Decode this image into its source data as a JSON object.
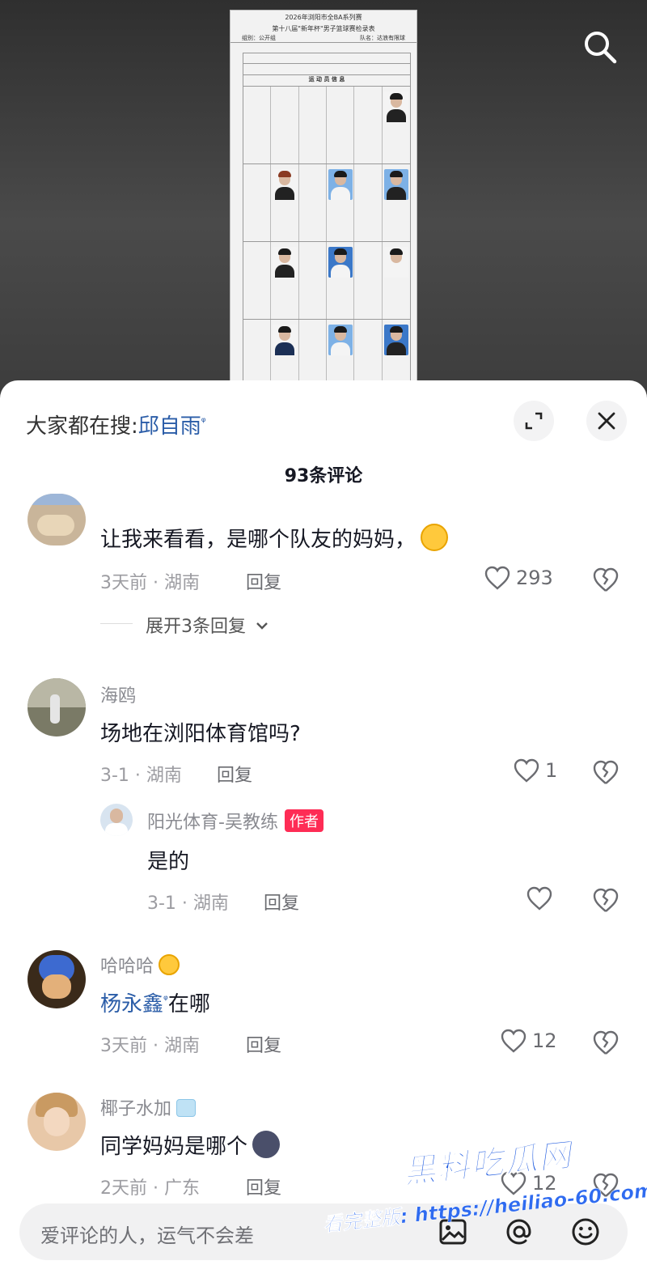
{
  "document": {
    "title_line1": "2026年浏阳市全BA系列赛",
    "title_line2": "第十八届\"新年杯\"男子篮球赛检录表",
    "group_label": "组别：",
    "group_value": "公开组",
    "team_label": "队名：",
    "team_value": "达浪有限球",
    "section_title": "运 动 员 信 息"
  },
  "sheet": {
    "trending_prefix": "大家都在搜:",
    "trending_keyword": "邱自雨",
    "comment_count": "93条评论"
  },
  "comments": [
    {
      "text": "让我来看看，是哪个队友的妈妈，",
      "time_location": "3天前 · 湖南",
      "reply_label": "回复",
      "likes": "293",
      "expand": "展开3条回复"
    },
    {
      "username": "海鸥",
      "text": "场地在浏阳体育馆吗?",
      "time_location": "3-1 · 湖南",
      "reply_label": "回复",
      "likes": "1",
      "sub_reply": {
        "username": "阳光体育-吴教练",
        "badge": "作者",
        "text": "是的",
        "time_location": "3-1 · 湖南",
        "reply_label": "回复"
      }
    },
    {
      "username": "哈哈哈",
      "text_link": "杨永鑫",
      "text": "在哪",
      "time_location": "3天前 · 湖南",
      "reply_label": "回复",
      "likes": "12"
    },
    {
      "username": "椰子水加",
      "text": "同学妈妈是哪个",
      "time_location": "2天前 · 广东",
      "reply_label": "回复",
      "likes": "12"
    }
  ],
  "input": {
    "placeholder": "爱评论的人，运气不会差"
  },
  "watermark": {
    "logo": "黑料吃瓜网",
    "url_text": "看完整版: https://heiliao-60.com"
  },
  "colors": {
    "link": "#2b5da8",
    "author_badge": "#fe2c55"
  },
  "icons": [
    "search-icon",
    "expand-icon",
    "close-icon",
    "heart-icon",
    "broken-heart-icon",
    "chevron-down-icon",
    "image-icon",
    "at-icon",
    "emoji-icon"
  ]
}
